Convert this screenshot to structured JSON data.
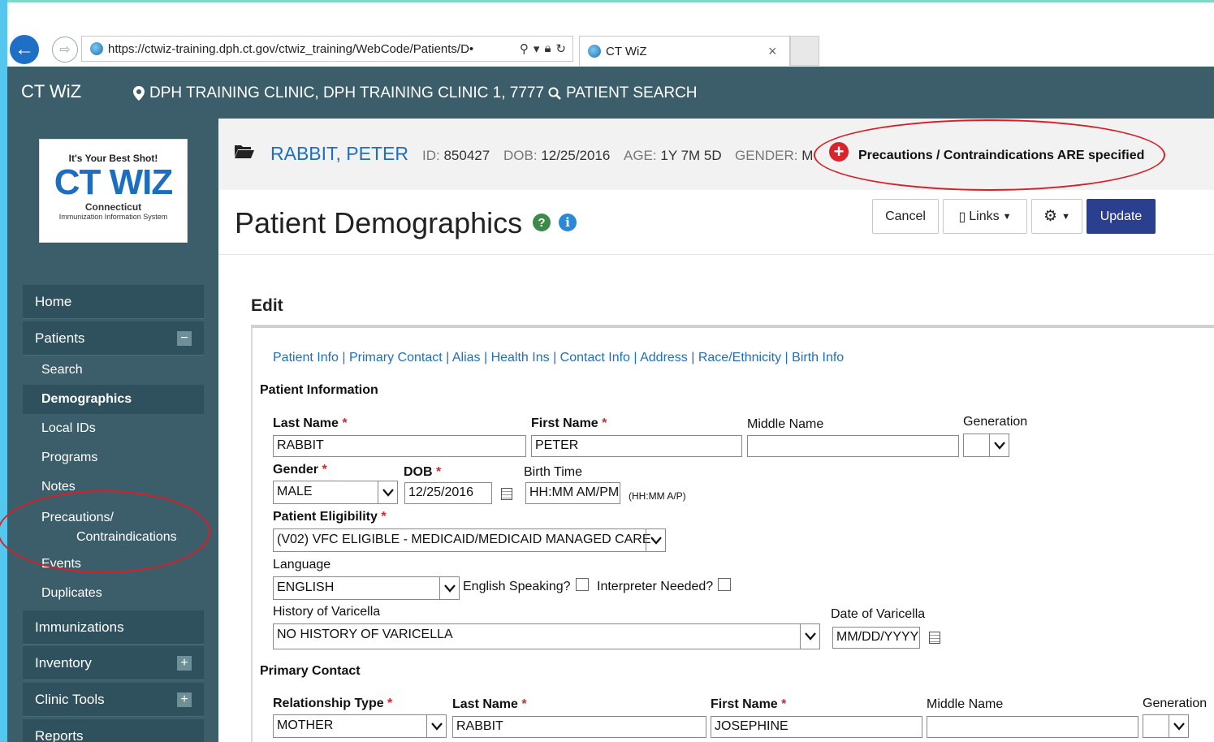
{
  "browser": {
    "url": "https://ctwiz-training.dph.ct.gov/ctwiz_training/WebCode/Patients/D•",
    "tab_title": "CT WiZ",
    "tab_close": "×"
  },
  "appbar": {
    "title": "CT WiZ",
    "clinic": "DPH TRAINING CLINIC, DPH TRAINING CLINIC 1, 7777",
    "patient_search": "PATIENT SEARCH"
  },
  "logo": {
    "tagline": "It's Your Best Shot!",
    "name": "CT WIZ",
    "state": "Connecticut",
    "system": "Immunization Information System"
  },
  "sidebar": {
    "home": "Home",
    "patients": "Patients",
    "patients_sub": [
      "Search",
      "Demographics",
      "Local IDs",
      "Programs",
      "Notes",
      "Precautions/",
      "Contraindications",
      "Events",
      "Duplicates"
    ],
    "immunizations": "Immunizations",
    "inventory": "Inventory",
    "clinic_tools": "Clinic Tools",
    "reports": "Reports"
  },
  "patient": {
    "name": "RABBIT, PETER",
    "id_label": "ID:",
    "id": "850427",
    "dob_label": "DOB:",
    "dob": "12/25/2016",
    "age_label": "AGE:",
    "age": "1Y 7M 5D",
    "gender_label": "GENDER:",
    "gender": "M",
    "precautions": "Precautions / Contraindications ARE specified"
  },
  "page": {
    "title": "Patient Demographics",
    "cancel": "Cancel",
    "links": "Links",
    "update": "Update",
    "edit": "Edit"
  },
  "section_links": "Patient Info  | Primary Contact  | Alias  | Health Ins  | Contact Info  | Address  | Race/Ethnicity  | Birth Info",
  "patient_info": {
    "header": "Patient Information",
    "last_name_label": "Last Name",
    "last_name": "RABBIT",
    "first_name_label": "First Name",
    "first_name": "PETER",
    "middle_name_label": "Middle Name",
    "middle_name": "",
    "generation_label": "Generation",
    "gender_label": "Gender",
    "gender": "MALE",
    "dob_label": "DOB",
    "dob": "12/25/2016",
    "birth_time_label": "Birth Time",
    "birth_time": "HH:MM AM/PM",
    "birth_time_hint": "(HH:MM A/P)",
    "eligibility_label": "Patient Eligibility",
    "eligibility": "(V02) VFC ELIGIBLE - MEDICAID/MEDICAID MANAGED CARE",
    "language_label": "Language",
    "language": "ENGLISH",
    "english_speaking_label": "English Speaking?",
    "interpreter_label": "Interpreter Needed?",
    "varicella_history_label": "History of Varicella",
    "varicella_history": "NO HISTORY OF VARICELLA",
    "varicella_date_label": "Date of Varicella",
    "varicella_date": "MM/DD/YYYY"
  },
  "primary_contact": {
    "header": "Primary Contact",
    "relationship_label": "Relationship Type",
    "relationship": "MOTHER",
    "last_name_label": "Last Name",
    "last_name": "RABBIT",
    "first_name_label": "First Name",
    "first_name": "JOSEPHINE",
    "middle_name_label": "Middle Name",
    "generation_label": "Generation"
  },
  "colors": {
    "brand_dark": "#3c5e6a",
    "link_blue": "#1d6fc0",
    "alert_red": "#d9242e",
    "update_button": "#2b3f8f"
  }
}
